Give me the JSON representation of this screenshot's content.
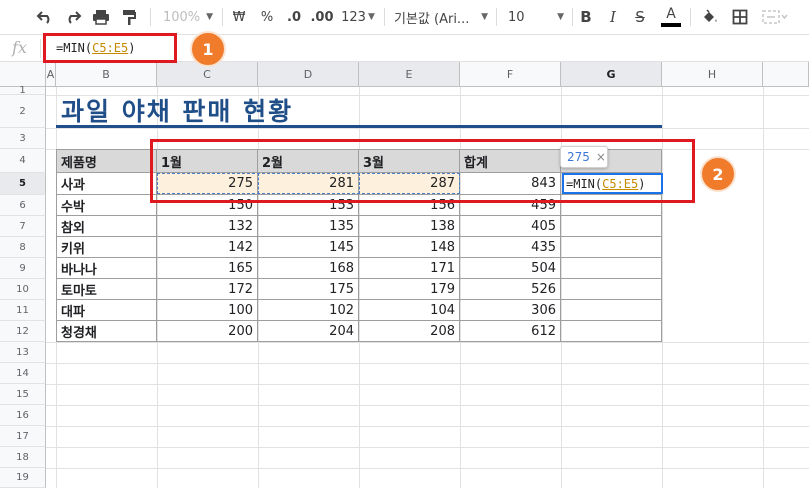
{
  "toolbar": {
    "zoom": "100%",
    "currency": "₩",
    "percent": "%",
    "decrease_decimal": ".0",
    "increase_decimal": ".00",
    "number_format": "123",
    "font": "기본값 (Ari...",
    "font_size": "10",
    "bold": "B",
    "italic": "I",
    "strikethrough": "S",
    "text_color": "A"
  },
  "formula_bar": {
    "fx": "fx",
    "prefix": "=MIN(",
    "range": "C5:E5",
    "suffix": ")"
  },
  "columns": [
    "A",
    "B",
    "C",
    "D",
    "E",
    "F",
    "G",
    "H"
  ],
  "rows": [
    "1",
    "2",
    "3",
    "4",
    "5",
    "6",
    "7",
    "8",
    "9",
    "10",
    "11",
    "12",
    "13",
    "14",
    "15",
    "16",
    "17",
    "18",
    "19"
  ],
  "title": "과일 야채 판매 현황",
  "table": {
    "headers": [
      "제품명",
      "1월",
      "2월",
      "3월",
      "합계"
    ],
    "rows": [
      {
        "name": "사과",
        "values": [
          "275",
          "281",
          "287",
          "843"
        ]
      },
      {
        "name": "수박",
        "values": [
          "150",
          "153",
          "156",
          "459"
        ]
      },
      {
        "name": "참외",
        "values": [
          "132",
          "135",
          "138",
          "405"
        ]
      },
      {
        "name": "키위",
        "values": [
          "142",
          "145",
          "148",
          "435"
        ]
      },
      {
        "name": "바나나",
        "values": [
          "165",
          "168",
          "171",
          "504"
        ]
      },
      {
        "name": "토마토",
        "values": [
          "172",
          "175",
          "179",
          "526"
        ]
      },
      {
        "name": "대파",
        "values": [
          "100",
          "102",
          "104",
          "306"
        ]
      },
      {
        "name": "청경채",
        "values": [
          "200",
          "204",
          "208",
          "612"
        ]
      }
    ]
  },
  "active_cell": {
    "prefix": "=MIN(",
    "range": "C5:E5",
    "suffix": ")"
  },
  "tooltip": {
    "value": "275",
    "close": "×"
  },
  "annotations": {
    "badge1": "1",
    "badge2": "2"
  },
  "colors": {
    "accent": "#1f4e88",
    "annotation_red": "#e0181f",
    "badge_orange": "#ef7b2b",
    "selection_blue": "#1a73e8",
    "range_fill": "#fdf0dc",
    "reference_orange": "#c58b00"
  }
}
